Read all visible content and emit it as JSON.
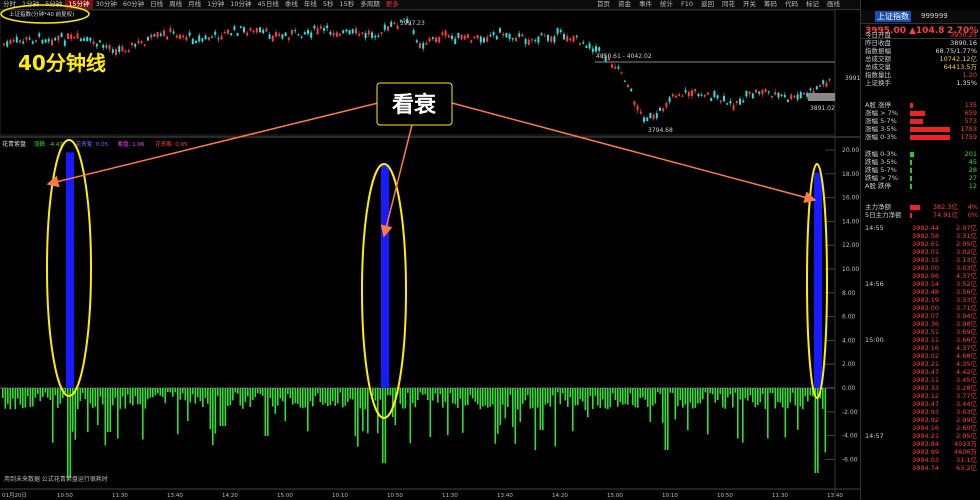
{
  "toolbar": {
    "left_tabs": [
      "分时",
      "1分钟",
      "5分钟",
      "15分钟",
      "30分钟",
      "60分钟",
      "日线",
      "周线",
      "月线",
      "1分钟",
      "10分钟",
      "45日线",
      "季线",
      "年线",
      "5秒",
      "15秒",
      "多周期",
      "更多"
    ],
    "selected_index": 3,
    "hot_index": 17,
    "right_tabs": [
      "首页",
      "资金",
      "事件",
      "统计",
      "F10",
      "返回",
      "同花",
      "开关",
      "筹码",
      "代码",
      "标记",
      "画线"
    ],
    "g_label": "G"
  },
  "main_chart": {
    "indicator_label": "上证指数(分钟*40 前复权)",
    "big_title": "40分钟线",
    "price_high": "3997.23",
    "price_low": "3794.68",
    "band_label": "4050.61 - 4042.02",
    "ref_price": "3891.02",
    "axis_price": "3991"
  },
  "annotation": {
    "text": "看衰",
    "ellipse_color": "#ffee00",
    "arrow_color": "#ff7a45"
  },
  "sub_chart": {
    "indicator_title": "花青紫盘",
    "legend": [
      {
        "text": "涨跌: -4.47",
        "color": "#2de02d"
      },
      {
        "text": "花青紫: 0.05",
        "color": "#6a6aff"
      },
      {
        "text": "紫盘: 1.06",
        "color": "#ff3dff"
      },
      {
        "text": "花青紫: 0.05",
        "color": "#ff3d3d"
      }
    ],
    "y_ticks": [
      "20.00",
      "18.00",
      "16.00",
      "14.00",
      "12.00",
      "10.00",
      "8.00",
      "6.00",
      "4.00",
      "2.00",
      "0.00",
      "-2.00",
      "-4.00",
      "-6.00"
    ],
    "footer_note": "用到未来数据  公式花青紫盘运行很耗时",
    "blue_bar_heights": [
      19.8,
      18.8,
      18.1
    ],
    "x_labels": [
      "01月20日",
      "10:50",
      "11:30",
      "13:40",
      "14:20",
      "15:00",
      "10:10",
      "10:50",
      "11:30",
      "13:40",
      "14:20",
      "15:00",
      "10:10",
      "10:50",
      "11:30",
      "13:40"
    ]
  },
  "side": {
    "name": "上证指数",
    "code": "999999",
    "price": "3995.00",
    "change": "▲104.8",
    "pct": "2.70%",
    "stats": [
      {
        "k": "今日开盘",
        "v": "3930.25",
        "c": "red"
      },
      {
        "k": "昨日收盘",
        "v": "3890.16",
        "c": "white"
      },
      {
        "k": "指数振幅",
        "v": "68.75/1.77%",
        "c": "white"
      },
      {
        "k": "总成交额",
        "v": "10742.12亿",
        "c": "yel"
      },
      {
        "k": "总成交量",
        "v": "64413.5万",
        "c": "yel"
      },
      {
        "k": "指数量比",
        "v": "1.20",
        "c": "red"
      },
      {
        "k": "上证换手",
        "v": "1.35%",
        "c": "white"
      }
    ],
    "up_dist": [
      {
        "k": "A股 涨停",
        "v": "135",
        "frac": 0.08
      },
      {
        "k": "涨幅 > 7%",
        "v": "659",
        "frac": 0.37
      },
      {
        "k": "涨幅 5-7%",
        "v": "573",
        "frac": 0.32
      },
      {
        "k": "涨幅 3-5%",
        "v": "1783",
        "frac": 1.0
      },
      {
        "k": "涨幅 0-3%",
        "v": "1759",
        "frac": 0.99
      }
    ],
    "down_dist": [
      {
        "k": "跌幅 0-3%",
        "v": "201",
        "frac": 0.11
      },
      {
        "k": "跌幅 3-5%",
        "v": "45",
        "frac": 0.03
      },
      {
        "k": "跌幅 5-7%",
        "v": "28",
        "frac": 0.02
      },
      {
        "k": "跌幅 > 7%",
        "v": "27",
        "frac": 0.02
      },
      {
        "k": "A股 跌停",
        "v": "12",
        "frac": 0.01
      }
    ],
    "flow": [
      {
        "k": "主力净额",
        "v": "382.3亿",
        "p": "4%",
        "frac": 0.5
      },
      {
        "k": "5日主力净额",
        "v": "74.91亿",
        "p": "0%",
        "frac": 0.12
      }
    ],
    "ticks": [
      {
        "t": "14:55",
        "p": "3992.44",
        "a": "2.97亿"
      },
      {
        "t": "",
        "p": "3992.58",
        "a": "3.31亿"
      },
      {
        "t": "",
        "p": "3992.61",
        "a": "2.95亿"
      },
      {
        "t": "",
        "p": "3993.01",
        "a": "3.02亿"
      },
      {
        "t": "",
        "p": "3993.15",
        "a": "3.13亿"
      },
      {
        "t": "",
        "p": "3993.00",
        "a": "3.03亿"
      },
      {
        "t": "",
        "p": "3992.96",
        "a": "4.37亿"
      },
      {
        "t": "14:56",
        "p": "3993.14",
        "a": "3.52亿"
      },
      {
        "t": "",
        "p": "3993.48",
        "a": "3.56亿"
      },
      {
        "t": "",
        "p": "3993.19",
        "a": "3.33亿"
      },
      {
        "t": "",
        "p": "3993.00",
        "a": "3.71亿"
      },
      {
        "t": "",
        "p": "3993.07",
        "a": "3.94亿"
      },
      {
        "t": "",
        "p": "3993.36",
        "a": "3.98亿"
      },
      {
        "t": "",
        "p": "3993.51",
        "a": "3.69亿"
      },
      {
        "t": "15:00",
        "p": "3993.11",
        "a": "3.66亿"
      },
      {
        "t": "",
        "p": "3993.16",
        "a": "4.37亿"
      },
      {
        "t": "",
        "p": "3993.02",
        "a": "4.68亿"
      },
      {
        "t": "",
        "p": "3993.21",
        "a": "4.35亿"
      },
      {
        "t": "",
        "p": "3993.47",
        "a": "4.42亿"
      },
      {
        "t": "",
        "p": "3993.11",
        "a": "3.45亿"
      },
      {
        "t": "",
        "p": "3993.33",
        "a": "3.28亿"
      },
      {
        "t": "",
        "p": "3993.12",
        "a": "3.77亿"
      },
      {
        "t": "",
        "p": "3993.47",
        "a": "3.44亿"
      },
      {
        "t": "",
        "p": "3993.93",
        "a": "3.63亿"
      },
      {
        "t": "",
        "p": "3993.92",
        "a": "2.99亿"
      },
      {
        "t": "",
        "p": "3994.16",
        "a": "2.60亿"
      },
      {
        "t": "14:57",
        "p": "3994.21",
        "a": "2.95亿"
      },
      {
        "t": "",
        "p": "3993.84",
        "a": "4033万"
      },
      {
        "t": "",
        "p": "3993.99",
        "a": "4606万"
      },
      {
        "t": "",
        "p": "3994.03",
        "a": "31.1亿"
      },
      {
        "t": "",
        "p": "3994.74",
        "a": "63.2亿"
      }
    ]
  }
}
